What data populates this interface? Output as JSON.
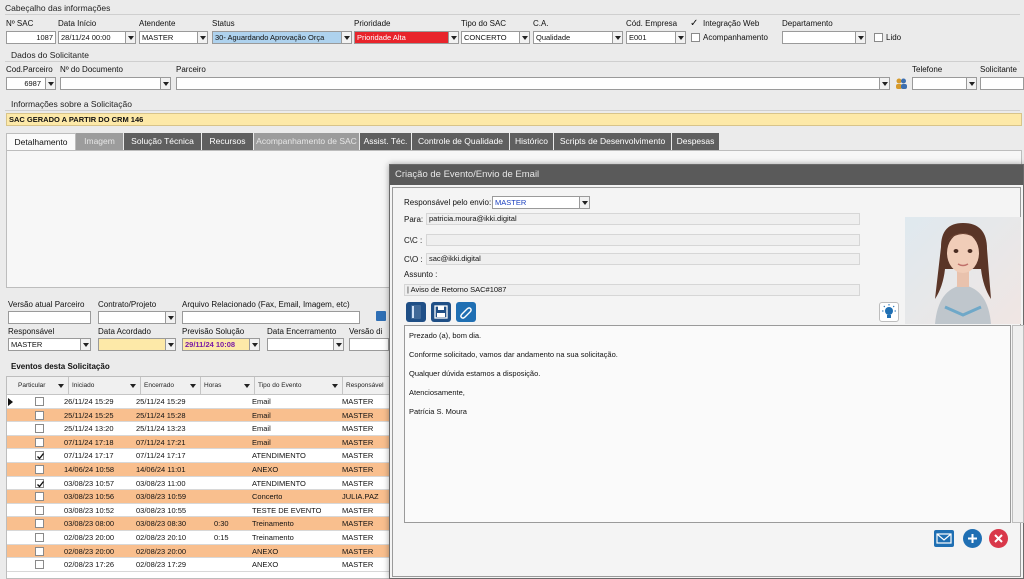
{
  "header": {
    "section_title": "Cabeçalho das informações",
    "fields": {
      "nsac": {
        "label": "Nº SAC",
        "value": "1087"
      },
      "data_inicio": {
        "label": "Data Início",
        "value": "28/11/24 00:00"
      },
      "atendente": {
        "label": "Atendente",
        "value": "MASTER"
      },
      "status": {
        "label": "Status",
        "value": "30- Aguardando Aprovação Orça"
      },
      "prioridade": {
        "label": "Prioridade",
        "value": "Prioridade Alta"
      },
      "tipo_sac": {
        "label": "Tipo do SAC",
        "value": "CONCERTO"
      },
      "ca": {
        "label": "C.A.",
        "value": "Qualidade"
      },
      "cod_empresa": {
        "label": "Cód. Empresa",
        "value": "E001"
      },
      "integracao_web": {
        "label": "Integração Web",
        "checked": true
      },
      "acompanhamento": {
        "label": "Acompanhamento",
        "checked": false
      },
      "departamento": {
        "label": "Departamento",
        "value": ""
      },
      "lido": {
        "label": "Lido",
        "checked": false
      }
    }
  },
  "solicitante": {
    "section_title": "Dados do Solicitante",
    "cod_parceiro": {
      "label": "Cod.Parceiro",
      "value": "6987"
    },
    "n_documento": {
      "label": "Nº do Documento",
      "value": ""
    },
    "parceiro": {
      "label": "Parceiro",
      "value": ""
    },
    "telefone": {
      "label": "Telefone",
      "value": ""
    },
    "solicitante": {
      "label": "Solicitante",
      "value": ""
    }
  },
  "info": {
    "section_title": "Informações sobre a Solicitação",
    "text": "SAC GERADO A PARTIR DO CRM 146"
  },
  "tabs": [
    {
      "label": "Detalhamento",
      "state": "active"
    },
    {
      "label": "Imagem",
      "state": "dim"
    },
    {
      "label": "Solução Técnica",
      "state": "normal"
    },
    {
      "label": "Recursos",
      "state": "normal"
    },
    {
      "label": "Acompanhamento de SAC",
      "state": "dim"
    },
    {
      "label": "Assist. Téc.",
      "state": "normal"
    },
    {
      "label": "Controle de Qualidade",
      "state": "normal"
    },
    {
      "label": "Histórico",
      "state": "normal"
    },
    {
      "label": "Scripts de Desenvolvimento",
      "state": "normal"
    },
    {
      "label": "Despesas",
      "state": "normal"
    }
  ],
  "lower": {
    "versao_atual": "Versão atual Parceiro",
    "contrato": "Contrato/Projeto",
    "arquivo": "Arquivo Relacionado (Fax, Email, Imagem, etc)",
    "responsavel": {
      "label": "Responsável",
      "value": "MASTER"
    },
    "data_acordado": {
      "label": "Data Acordado",
      "value": ""
    },
    "previsao": {
      "label": "Previsão Solução",
      "value": "29/11/24 10:08"
    },
    "data_encerramento": {
      "label": "Data Encerramento",
      "value": ""
    },
    "versao_di": {
      "label": "Versão di",
      "value": ""
    }
  },
  "events": {
    "title": "Eventos desta Solicitação",
    "columns": [
      "Particular",
      "Iniciado",
      "Encerrado",
      "Horas",
      "Tipo do Evento",
      "Responsável"
    ],
    "rows": [
      {
        "checked": false,
        "ini": "26/11/24 15:29",
        "enc": "25/11/24 15:29",
        "horas": "",
        "tipo": "Email",
        "resp": "MASTER",
        "color": "#ffffff",
        "current": true
      },
      {
        "checked": false,
        "ini": "25/11/24 15:25",
        "enc": "25/11/24 15:28",
        "horas": "",
        "tipo": "Email",
        "resp": "MASTER",
        "color": "#f9bf8e"
      },
      {
        "checked": false,
        "ini": "25/11/24 13:20",
        "enc": "25/11/24 13:23",
        "horas": "",
        "tipo": "Email",
        "resp": "MASTER",
        "color": "#ffffff"
      },
      {
        "checked": false,
        "ini": "07/11/24 17:18",
        "enc": "07/11/24 17:21",
        "horas": "",
        "tipo": "Email",
        "resp": "MASTER",
        "color": "#f9bf8e"
      },
      {
        "checked": true,
        "ini": "07/11/24 17:17",
        "enc": "07/11/24 17:17",
        "horas": "",
        "tipo": "ATENDIMENTO",
        "resp": "MASTER",
        "color": "#ffffff"
      },
      {
        "checked": false,
        "ini": "14/06/24 10:58",
        "enc": "14/06/24 11:01",
        "horas": "",
        "tipo": "ANEXO",
        "resp": "MASTER",
        "color": "#f9bf8e"
      },
      {
        "checked": true,
        "ini": "03/08/23 10:57",
        "enc": "03/08/23 11:00",
        "horas": "",
        "tipo": "ATENDIMENTO",
        "resp": "MASTER",
        "color": "#ffffff"
      },
      {
        "checked": false,
        "ini": "03/08/23 10:56",
        "enc": "03/08/23 10:59",
        "horas": "",
        "tipo": "Concerto",
        "resp": "JULIA.PAZ",
        "color": "#f9bf8e"
      },
      {
        "checked": false,
        "ini": "03/08/23 10:52",
        "enc": "03/08/23 10:55",
        "horas": "",
        "tipo": "TESTE DE EVENTO",
        "resp": "MASTER",
        "color": "#ffffff"
      },
      {
        "checked": false,
        "ini": "03/08/23 08:00",
        "enc": "03/08/23 08:30",
        "horas": "0:30",
        "tipo": "Treinamento",
        "resp": "MASTER",
        "color": "#f9bf8e"
      },
      {
        "checked": false,
        "ini": "02/08/23 20:00",
        "enc": "02/08/23 20:10",
        "horas": "0:15",
        "tipo": "Treinamento",
        "resp": "MASTER",
        "color": "#ffffff"
      },
      {
        "checked": false,
        "ini": "02/08/23 20:00",
        "enc": "02/08/23 20:00",
        "horas": "",
        "tipo": "ANEXO",
        "resp": "MASTER",
        "color": "#f9bf8e"
      },
      {
        "checked": false,
        "ini": "02/08/23 17:26",
        "enc": "02/08/23 17:29",
        "horas": "",
        "tipo": "ANEXO",
        "resp": "MASTER",
        "color": "#ffffff"
      }
    ]
  },
  "modal": {
    "title": "Criação de Evento/Envio de Email",
    "responsavel": {
      "label": "Responsável pelo envio:",
      "value": "MASTER"
    },
    "para": {
      "label": "Para:",
      "value": "patricia.moura@ikki.digital"
    },
    "cc": {
      "label": "C\\C :",
      "value": ""
    },
    "co": {
      "label": "C\\O :",
      "value": "sac@ikki.digital"
    },
    "assunto": {
      "label": "Assunto :",
      "value": "| Aviso de Retorno SAC#1087"
    },
    "body_lines": [
      "Prezado (a), bom dia.",
      "Conforme solicitado, vamos dar andamento na sua solicitação.",
      "Qualquer dúvida estamos a disposição.",
      "Atenciosamente,",
      "Patrícia S. Moura"
    ],
    "toolbar_icons": [
      "book-icon",
      "save-icon",
      "paperclip-icon"
    ],
    "tip_icon": "lightbulb-icon",
    "action_icons": [
      "email-send-icon",
      "add-icon",
      "cancel-icon"
    ]
  },
  "colors": {
    "prioridade_bg": "#e8242b",
    "status_bg": "#aed2ee",
    "info_bar_bg": "#fde9a8",
    "row_orange": "#f9bf8e",
    "modal_title_bg": "#5a5a5a",
    "modal_blue_icon": "#1f6fb3",
    "cancel_red": "#d9384a"
  }
}
